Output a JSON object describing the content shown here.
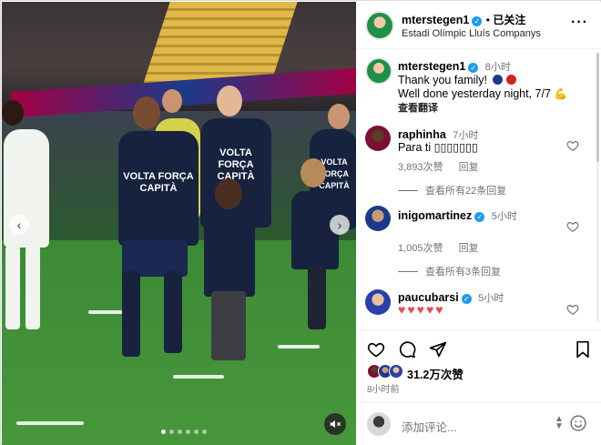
{
  "post": {
    "username": "mterstegen1",
    "follow_status": "已关注",
    "location": "Estadi Olímpic Lluís Companys",
    "caption_time": "8小时",
    "caption_line1": "Thank you family!",
    "caption_line2": "Well done yesterday night, 7/7",
    "see_translation": "查看翻译",
    "likes": "31.2万次赞",
    "posted_ago": "8小时前"
  },
  "media": {
    "shirt_text_1": "VOLTA FORÇA\nCAPITÀ",
    "shirt_text_2": "VOLTA FORÇA\nCAPITÀ",
    "shirt_text_3": "VOLTA FORÇA\nCAPITÀ",
    "prev_label": "‹",
    "next_label": "›",
    "slide_count": 6,
    "active_slide": 1
  },
  "comments": [
    {
      "username": "raphinha",
      "time": "7小时",
      "text": "Para ti 󠁶󠁶󠁶󠁶󠁶󠁶",
      "text_display": "Para ti ▯▯▯▯▯▯▯",
      "likes": "3,893次赞",
      "reply": "回复",
      "view_replies": "查看所有22条回复",
      "verified": false
    },
    {
      "username": "inigomartinez",
      "time": "5小时",
      "text": "",
      "likes": "1,005次赞",
      "reply": "回复",
      "view_replies": "查看所有3条回复",
      "verified": true
    },
    {
      "username": "paucubarsi",
      "time": "5小时",
      "text": "♥♥♥♥♥",
      "likes": "",
      "reply": "",
      "view_replies": "",
      "verified": true
    }
  ],
  "add_comment": {
    "placeholder": "添加评论..."
  },
  "colors": {
    "verified": "#1d9bf0",
    "heart_red": "#ed4956",
    "muted_text": "#737373",
    "barca_blue": "#1b3a8a",
    "barca_red": "#a50044"
  },
  "icons": {
    "like": "heart-outline-icon",
    "comment": "speech-bubble-icon",
    "share": "paper-plane-icon",
    "save": "bookmark-icon",
    "more": "more-dots-icon",
    "emoji": "smiley-icon",
    "mute": "speaker-muted-icon"
  }
}
